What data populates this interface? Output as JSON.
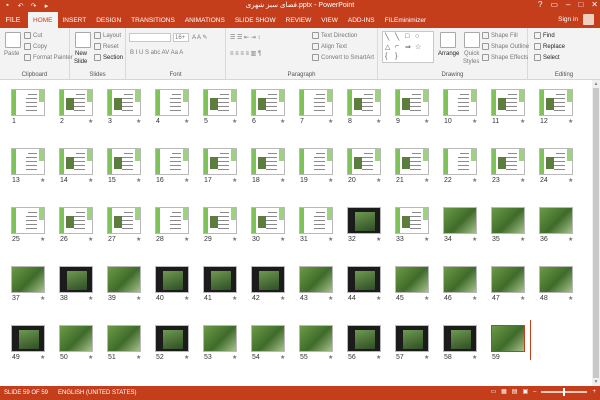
{
  "window": {
    "title": "فضای سبز شهری.pptx - PowerPoint",
    "controls": [
      "?",
      "▭",
      "–",
      "□",
      "✕"
    ]
  },
  "quick_access": [
    "save-icon",
    "undo-icon",
    "redo-icon",
    "start-from-beginning-icon"
  ],
  "tabs": {
    "file": "FILE",
    "items": [
      "HOME",
      "INSERT",
      "DESIGN",
      "TRANSITIONS",
      "ANIMATIONS",
      "SLIDE SHOW",
      "REVIEW",
      "VIEW",
      "ADD-INS",
      "FILEminimizer"
    ],
    "active": "HOME",
    "sign_in": "Sign in"
  },
  "ribbon": {
    "clipboard": {
      "label": "Clipboard",
      "paste": "Paste",
      "cut": "Cut",
      "copy": "Copy",
      "format_painter": "Format Painter"
    },
    "slides": {
      "label": "Slides",
      "new_slide": "New",
      "new_slide_2": "Slide",
      "layout": "Layout",
      "reset": "Reset",
      "section": "Section"
    },
    "font": {
      "label": "Font",
      "size": "16+"
    },
    "paragraph": {
      "label": "Paragraph",
      "text_direction": "Text Direction",
      "align_text": "Align Text",
      "convert_smartart": "Convert to SmartArt"
    },
    "drawing": {
      "label": "Drawing",
      "arrange": "Arrange",
      "quick_styles": "Quick",
      "quick_styles_2": "Styles",
      "shape_fill": "Shape Fill",
      "shape_outline": "Shape Outline",
      "shape_effects": "Shape Effects"
    },
    "editing": {
      "label": "Editing",
      "find": "Find",
      "replace": "Replace",
      "select": "Select"
    }
  },
  "slides": [
    {
      "n": "1",
      "type": "light",
      "star": ""
    },
    {
      "n": "2",
      "type": "light",
      "star": "★"
    },
    {
      "n": "3",
      "type": "light",
      "star": "★"
    },
    {
      "n": "4",
      "type": "light",
      "star": "★"
    },
    {
      "n": "5",
      "type": "light",
      "star": "★"
    },
    {
      "n": "6",
      "type": "light",
      "star": "★"
    },
    {
      "n": "7",
      "type": "light",
      "star": "★"
    },
    {
      "n": "8",
      "type": "light",
      "star": "★"
    },
    {
      "n": "9",
      "type": "light",
      "star": "★"
    },
    {
      "n": "10",
      "type": "light",
      "star": "★"
    },
    {
      "n": "11",
      "type": "light",
      "star": "★"
    },
    {
      "n": "12",
      "type": "light",
      "star": "★"
    },
    {
      "n": "13",
      "type": "light",
      "star": "★"
    },
    {
      "n": "14",
      "type": "light",
      "star": "★"
    },
    {
      "n": "15",
      "type": "light",
      "star": "★"
    },
    {
      "n": "16",
      "type": "light",
      "star": "★"
    },
    {
      "n": "17",
      "type": "light",
      "star": "★"
    },
    {
      "n": "18",
      "type": "light",
      "star": "★"
    },
    {
      "n": "19",
      "type": "light",
      "star": "★"
    },
    {
      "n": "20",
      "type": "light",
      "star": "★"
    },
    {
      "n": "21",
      "type": "light",
      "star": "★"
    },
    {
      "n": "22",
      "type": "light",
      "star": "★"
    },
    {
      "n": "23",
      "type": "light",
      "star": "★"
    },
    {
      "n": "24",
      "type": "light",
      "star": "★"
    },
    {
      "n": "25",
      "type": "light",
      "star": "★"
    },
    {
      "n": "26",
      "type": "light",
      "star": "★"
    },
    {
      "n": "27",
      "type": "light",
      "star": "★"
    },
    {
      "n": "28",
      "type": "light",
      "star": "★"
    },
    {
      "n": "29",
      "type": "light",
      "star": "★"
    },
    {
      "n": "30",
      "type": "light",
      "star": "★"
    },
    {
      "n": "31",
      "type": "light",
      "star": "★"
    },
    {
      "n": "32",
      "type": "dark",
      "star": "★"
    },
    {
      "n": "33",
      "type": "light",
      "star": "★"
    },
    {
      "n": "34",
      "type": "photo",
      "star": "★"
    },
    {
      "n": "35",
      "type": "photo",
      "star": "★"
    },
    {
      "n": "36",
      "type": "photo",
      "star": "★"
    },
    {
      "n": "37",
      "type": "photo",
      "star": "★"
    },
    {
      "n": "38",
      "type": "dark",
      "star": "★"
    },
    {
      "n": "39",
      "type": "photo",
      "star": "★"
    },
    {
      "n": "40",
      "type": "dark",
      "star": "★"
    },
    {
      "n": "41",
      "type": "dark",
      "star": "★"
    },
    {
      "n": "42",
      "type": "dark",
      "star": "★"
    },
    {
      "n": "43",
      "type": "photo",
      "star": "★"
    },
    {
      "n": "44",
      "type": "dark",
      "star": "★"
    },
    {
      "n": "45",
      "type": "photo",
      "star": "★"
    },
    {
      "n": "46",
      "type": "photo",
      "star": "★"
    },
    {
      "n": "47",
      "type": "photo",
      "star": "★"
    },
    {
      "n": "48",
      "type": "photo",
      "star": "★"
    },
    {
      "n": "49",
      "type": "dark",
      "star": "★"
    },
    {
      "n": "50",
      "type": "photo",
      "star": "★"
    },
    {
      "n": "51",
      "type": "photo",
      "star": "★"
    },
    {
      "n": "52",
      "type": "dark",
      "star": "★"
    },
    {
      "n": "53",
      "type": "photo",
      "star": "★"
    },
    {
      "n": "54",
      "type": "photo",
      "star": "★"
    },
    {
      "n": "55",
      "type": "photo",
      "star": "★"
    },
    {
      "n": "56",
      "type": "dark",
      "star": "★"
    },
    {
      "n": "57",
      "type": "dark",
      "star": "★"
    },
    {
      "n": "58",
      "type": "dark",
      "star": "★"
    },
    {
      "n": "59",
      "type": "photo",
      "star": ""
    }
  ],
  "status": {
    "slide": "SLIDE 59 OF 59",
    "language": "ENGLISH (UNITED STATES)"
  },
  "colors": {
    "accent": "#c43e1c",
    "ribbon_bg": "#f3f3f3"
  }
}
